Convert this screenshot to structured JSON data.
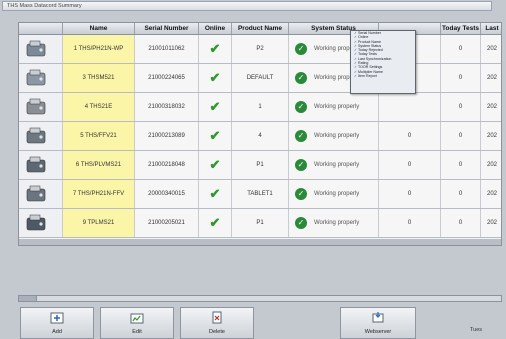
{
  "window": {
    "title": "THS Mass Datacord Summary"
  },
  "columns": {
    "name": "Name",
    "serial": "Serial Number",
    "online": "Online",
    "product": "Product Name",
    "status": "System Status",
    "today": "Today Tests",
    "last": "Last"
  },
  "rows": [
    {
      "name": "1 THS/PH21N-WP",
      "serial": "21001011062",
      "product": "P2",
      "status": "Working properly",
      "t1": "",
      "t2": "0",
      "last": "202"
    },
    {
      "name": "3 THSM521",
      "serial": "21000224065",
      "product": "DEFAULT",
      "status": "Working properly",
      "t1": "",
      "t2": "0",
      "last": "202"
    },
    {
      "name": "4 THS21E",
      "serial": "21000318032",
      "product": "1",
      "status": "Working properly",
      "t1": "",
      "t2": "0",
      "last": "202"
    },
    {
      "name": "5 THS/FFV21",
      "serial": "21000213089",
      "product": "4",
      "status": "Working properly",
      "t1": "0",
      "t2": "0",
      "last": "202"
    },
    {
      "name": "6 THS/PLVMS21",
      "serial": "21000218048",
      "product": "P1",
      "status": "Working properly",
      "t1": "0",
      "t2": "0",
      "last": "202"
    },
    {
      "name": "7 THS/PH21N-FFV",
      "serial": "20000340015",
      "product": "TABLET1",
      "status": "Working properly",
      "t1": "0",
      "t2": "0",
      "last": "202"
    },
    {
      "name": "9 TPLMS21",
      "serial": "21000205021",
      "product": "P1",
      "status": "Working properly",
      "t1": "0",
      "t2": "0",
      "last": "202"
    }
  ],
  "column_menu": [
    "Serial Number",
    "Online",
    "Product Name",
    "System Status",
    "Today Rejected",
    "Today Tests",
    "Last Synchronization",
    "Rating",
    "TOOR Settings",
    "Multiplier Name",
    "Item Report"
  ],
  "toolbar": {
    "add": "Add",
    "edit": "Edit",
    "delete": "Delete",
    "webserver": "Webserver",
    "today": "Tues"
  },
  "colors": {
    "name_highlight": "#fbf5a8",
    "ok_green": "#2a8a3a",
    "check_green": "#2e9a2e"
  }
}
